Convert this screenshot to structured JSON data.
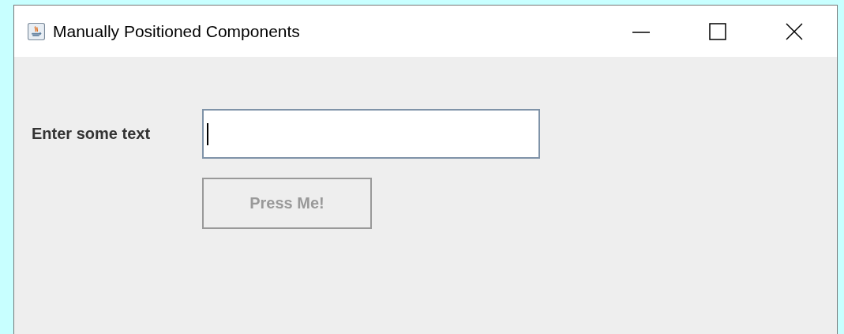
{
  "window": {
    "title": "Manually Positioned Components"
  },
  "form": {
    "label": "Enter some text",
    "text_field": {
      "focused": true
    },
    "button": {
      "label": "Press Me!",
      "disabled": true
    }
  }
}
